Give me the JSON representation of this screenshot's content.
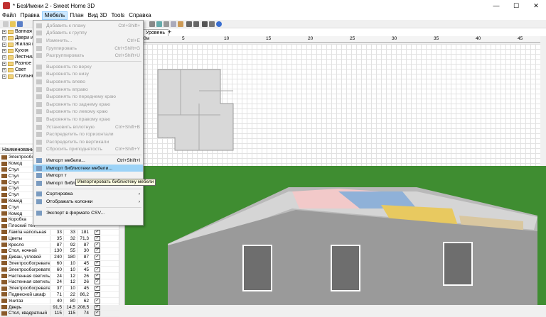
{
  "window": {
    "title": "* БезИмени 2 - Sweet Home 3D",
    "minimize": "—",
    "maximize": "☐",
    "close": "✕"
  },
  "menubar": [
    "Файл",
    "Правка",
    "Мебель",
    "План",
    "Вид 3D",
    "Tools",
    "Справка"
  ],
  "catalog": {
    "items": [
      "Ванная к",
      "Двери и",
      "Жилая к",
      "Кухня",
      "Лестница",
      "Разное",
      "Свет",
      "Стильные"
    ]
  },
  "furniture": {
    "header": "Наименование",
    "rows": [
      {
        "name": "Электрообог",
        "w": "",
        "d": "",
        "h": "",
        "v": false
      },
      {
        "name": "Комод",
        "w": "",
        "d": "",
        "h": "",
        "v": false
      },
      {
        "name": "Стул",
        "w": "",
        "d": "",
        "h": "",
        "v": false
      },
      {
        "name": "Стул",
        "w": "",
        "d": "",
        "h": "",
        "v": false
      },
      {
        "name": "Стул",
        "w": "",
        "d": "",
        "h": "",
        "v": false
      },
      {
        "name": "Стул",
        "w": "",
        "d": "",
        "h": "",
        "v": false
      },
      {
        "name": "Стул",
        "w": "",
        "d": "",
        "h": "",
        "v": false
      },
      {
        "name": "Комод",
        "w": "",
        "d": "",
        "h": "",
        "v": false
      },
      {
        "name": "Стул",
        "w": "",
        "d": "",
        "h": "",
        "v": false
      },
      {
        "name": "Комод",
        "w": "",
        "d": "",
        "h": "",
        "v": false
      },
      {
        "name": "Коробка",
        "w": "",
        "d": "",
        "h": "",
        "v": false
      },
      {
        "name": "Плоский тел",
        "w": "",
        "d": "",
        "h": "",
        "v": false
      },
      {
        "name": "Лампа напольная",
        "w": "33",
        "d": "33",
        "h": "181",
        "v": true
      },
      {
        "name": "Цветы",
        "w": "35",
        "d": "32",
        "h": "71,3",
        "v": true
      },
      {
        "name": "Кресло",
        "w": "87",
        "d": "92",
        "h": "87",
        "v": true
      },
      {
        "name": "Стол, ночной",
        "w": "130",
        "d": "55",
        "h": "30",
        "v": true
      },
      {
        "name": "Диван, угловой",
        "w": "240",
        "d": "180",
        "h": "87",
        "v": true
      },
      {
        "name": "Электрообогреватель",
        "w": "60",
        "d": "10",
        "h": "45",
        "v": true
      },
      {
        "name": "Электрообогреватель",
        "w": "60",
        "d": "10",
        "h": "45",
        "v": true
      },
      {
        "name": "Настенная светильн вверх",
        "w": "24",
        "d": "12",
        "h": "26",
        "v": true
      },
      {
        "name": "Настенная светильн вверх",
        "w": "24",
        "d": "12",
        "h": "26",
        "v": true
      },
      {
        "name": "Электрообогреватель",
        "w": "37",
        "d": "10",
        "h": "45",
        "v": true
      },
      {
        "name": "Подвесной шкаф",
        "w": "71",
        "d": "22",
        "h": "86,2",
        "v": true
      },
      {
        "name": "Унитаз",
        "w": "40",
        "d": "80",
        "h": "62",
        "v": true
      },
      {
        "name": "Дверь",
        "w": "91,5",
        "d": "14,5",
        "h": "208,5",
        "v": true
      },
      {
        "name": "Стол, квадратный",
        "w": "115",
        "d": "115",
        "h": "74",
        "v": true
      }
    ]
  },
  "plan": {
    "tab": "Уровень 1",
    "tab_add": "+",
    "ruler": [
      "0м",
      "5",
      "10",
      "15",
      "20",
      "25",
      "30",
      "35",
      "40",
      "45"
    ]
  },
  "menu": {
    "items": [
      {
        "label": "Добавить к плану",
        "shortcut": "Ctrl+Shift+",
        "enabled": false
      },
      {
        "label": "Добавить к группу",
        "shortcut": "",
        "enabled": false
      },
      {
        "label": "Изменить...",
        "shortcut": "Ctrl+E",
        "enabled": false
      },
      {
        "label": "Группировать",
        "shortcut": "Ctrl+Shift+G",
        "enabled": false
      },
      {
        "label": "Разгруппировать",
        "shortcut": "Ctrl+Shift+U",
        "enabled": false
      },
      {
        "sep": true
      },
      {
        "label": "Выровнять по верху",
        "shortcut": "",
        "enabled": false
      },
      {
        "label": "Выровнять по низу",
        "shortcut": "",
        "enabled": false
      },
      {
        "label": "Выровнять влево",
        "shortcut": "",
        "enabled": false
      },
      {
        "label": "Выровнять вправо",
        "shortcut": "",
        "enabled": false
      },
      {
        "label": "Выровнять по переднему краю",
        "shortcut": "",
        "enabled": false
      },
      {
        "label": "Выровнять по заднему краю",
        "shortcut": "",
        "enabled": false
      },
      {
        "label": "Выровнять по левому краю",
        "shortcut": "",
        "enabled": false
      },
      {
        "label": "Выровнять по правому краю",
        "shortcut": "",
        "enabled": false
      },
      {
        "label": "Установить вплотную",
        "shortcut": "Ctrl+Shift+B",
        "enabled": false
      },
      {
        "label": "Распределить по горизонтали",
        "shortcut": "",
        "enabled": false
      },
      {
        "label": "Распределить по вертикали",
        "shortcut": "",
        "enabled": false
      },
      {
        "label": "Сбросить приподнятость",
        "shortcut": "Ctrl+Shift+Y",
        "enabled": false
      },
      {
        "sep": true
      },
      {
        "label": "Импорт мебели...",
        "shortcut": "Ctrl+Shift+I",
        "enabled": true
      },
      {
        "label": "Импорт библиотеки мебели...",
        "shortcut": "",
        "enabled": true,
        "highlighted": true
      },
      {
        "label": "Импорт т",
        "shortcut": "",
        "enabled": true
      },
      {
        "label": "Импорт библиотеки текстур...",
        "shortcut": "",
        "enabled": true
      },
      {
        "sep": true
      },
      {
        "label": "Сортировка",
        "shortcut": "›",
        "enabled": true
      },
      {
        "label": "Отображать колонки",
        "shortcut": "›",
        "enabled": true
      },
      {
        "sep": true
      },
      {
        "label": "Экспорт в формате CSV...",
        "shortcut": "",
        "enabled": true
      }
    ]
  },
  "tooltip": "Импортировать библиотеку мебели",
  "colors": {
    "menu_highlight": "#9cd3f7",
    "menu_active": "#cce8ff",
    "grass": "#3c8a2e",
    "sky": "#2e7d2e"
  }
}
